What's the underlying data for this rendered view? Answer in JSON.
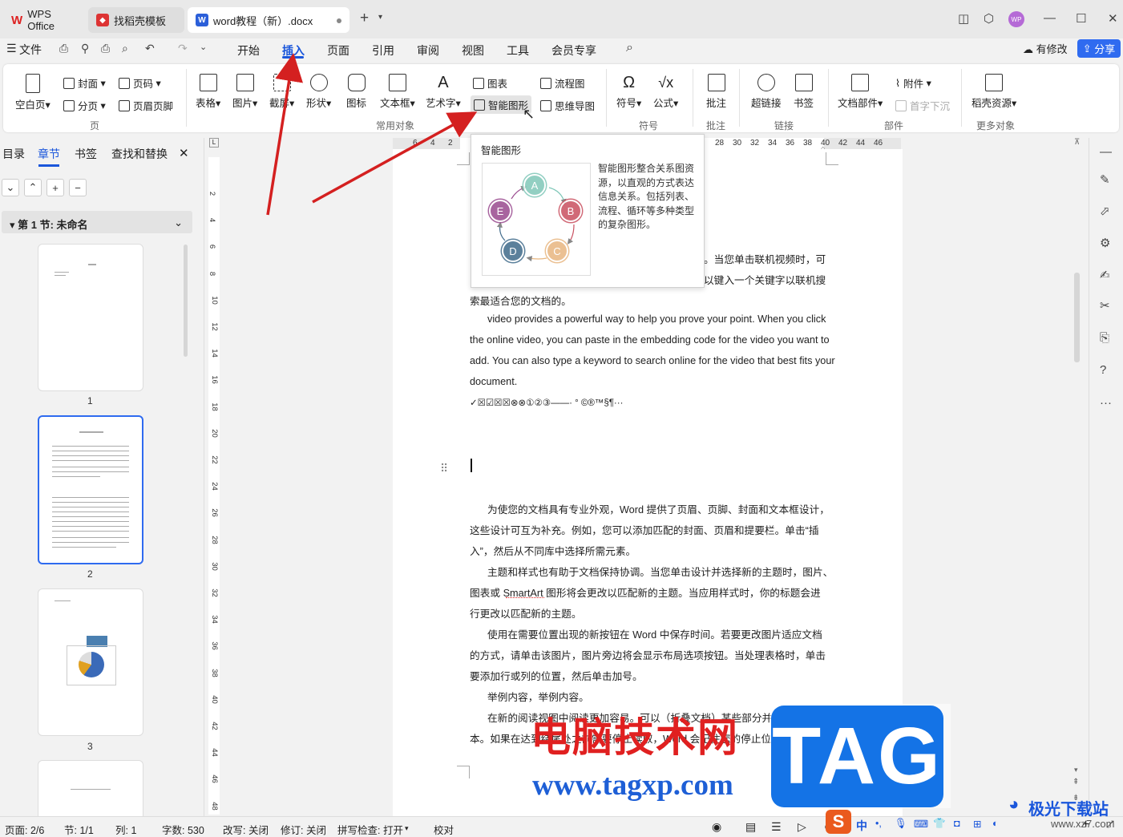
{
  "tabs": {
    "wps_office": "WPS Office",
    "template": "找稻壳模板",
    "document": "word教程（新）.docx",
    "new_tab": "+"
  },
  "menubar": {
    "file": "文件",
    "items": [
      "开始",
      "插入",
      "页面",
      "引用",
      "审阅",
      "视图",
      "工具",
      "会员专享"
    ],
    "active": "插入",
    "modified": "有修改",
    "share": "分享"
  },
  "ribbon": {
    "cover": "封面",
    "page_number": "页码",
    "blank_page": "空白页",
    "page_break": "分页",
    "header_footer": "页眉页脚",
    "group_page": "页",
    "table": "表格",
    "picture": "图片",
    "screenshot": "截屏",
    "shape": "形状",
    "icon": "图标",
    "textbox": "文本框",
    "wordart": "艺术字",
    "chart": "图表",
    "smartart": "智能图形",
    "flowchart": "流程图",
    "mindmap": "思维导图",
    "group_common": "常用对象",
    "symbol": "符号",
    "formula": "公式",
    "group_symbol": "符号",
    "comment": "批注",
    "group_comment": "批注",
    "hyperlink": "超链接",
    "bookmark": "书签",
    "group_link": "链接",
    "doc_parts": "文档部件",
    "attachment": "附件",
    "dropcap": "首字下沉",
    "group_parts": "部件",
    "daoke": "稻壳资源",
    "group_more": "更多对象"
  },
  "nav": {
    "tabs": [
      "目录",
      "章节",
      "书签",
      "查找和替换"
    ],
    "active": "章节",
    "section": "第 1 节: 未命名",
    "page_numbers": [
      "1",
      "2",
      "3"
    ]
  },
  "hruler_labels": [
    "6",
    "4",
    "2",
    "28",
    "30",
    "32",
    "34",
    "36",
    "38",
    "40",
    "42",
    "44",
    "46"
  ],
  "vruler_labels": [
    "2",
    "4",
    "6",
    "8",
    "10",
    "12",
    "14",
    "16",
    "18",
    "20",
    "22",
    "24",
    "26",
    "28",
    "30",
    "32",
    "34",
    "36",
    "38",
    "40",
    "42",
    "44",
    "46",
    "48"
  ],
  "tooltip": {
    "title": "智能图形",
    "description": "智能图形整合关系图资源，以直观的方式表达信息关系。包括列表、流程、循环等多种类型的复杂图形。",
    "nodes": [
      "A",
      "B",
      "C",
      "D",
      "E"
    ]
  },
  "document": {
    "lines": [
      "。当您单击联机视频时，可",
      "以键入一个关键字以联机搜",
      "索最适合您的文档的。",
      "video provides a powerful way to help you prove your point. When you click",
      "the online video, you can paste in the embedding code for the video you want to",
      "add. You can also type a keyword to search online for the video that best fits your",
      "document.",
      "✓☒☑☒☒⊗⊗①②③——·  °  ©®™§¶···",
      "为使您的文档具有专业外观，Word 提供了页眉、页脚、封面和文本框设计，",
      "这些设计可互为补充。例如，您可以添加匹配的封面、页眉和提要栏。单击“插",
      "入”，然后从不同库中选择所需元素。",
      "主题和样式也有助于文档保持协调。当您单击设计并选择新的主题时，图片、",
      "图表或 SmartArt 图形将会更改以匹配新的主题。当应用样式时，你的标题会进",
      "行更改以匹配新的主题。",
      "使用在需要位置出现的新按钮在 Word 中保存时间。若要更改图片适应文档",
      "的方式，请单击该图片，图片旁边将会显示布局选项按钮。当处理表格时，单击",
      "要添加行或列的位置，然后单击加号。",
      "举例内容，举例内容。",
      "在新的阅读视图中阅读更加容易。可以（折叠文档）某些部分并关注所需文",
      "本。如果在达到结尾处之前需要停止读取，Word 会记住您的停止位置 - 即使"
    ]
  },
  "statusbar": {
    "page": "页面: 2/6",
    "section": "节: 1/1",
    "column": "列: 1",
    "words": "字数: 530",
    "overwrite": "改写: 关闭",
    "revision": "修订: 关闭",
    "spellcheck": "拼写检查: 打开",
    "proofread": "校对",
    "ime": "中"
  },
  "watermark": {
    "cn": "电脑技术网",
    "url": "www.tagxp.com",
    "tag": "TAG",
    "site2": "极光下载站",
    "site2_url": "www.xz7.com"
  },
  "colors": {
    "accent": "#1a56db",
    "share_button": "#2f6bf0",
    "arrow": "#d42020",
    "node_a": "#7fc7b8",
    "node_b": "#c95060",
    "node_c": "#e8b67f",
    "node_d": "#3f6a8a",
    "node_e": "#9a4a8f"
  }
}
